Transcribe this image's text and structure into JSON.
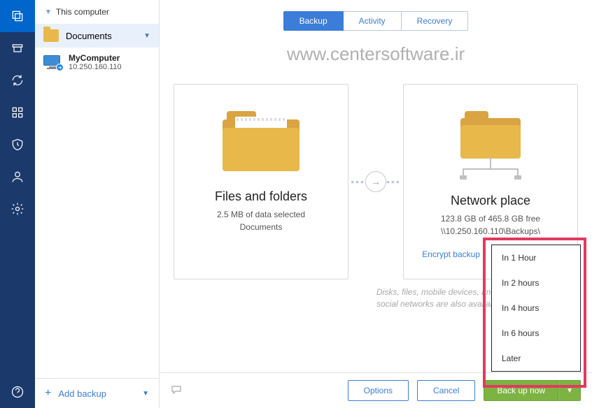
{
  "rail": {
    "items": [
      "copy",
      "archive",
      "sync",
      "grid",
      "shield",
      "user",
      "settings",
      "help"
    ]
  },
  "sidebar": {
    "header": "This computer",
    "documents_label": "Documents",
    "device": {
      "name": "MyComputer",
      "address": "10.250.160.110"
    },
    "add_backup": "Add backup"
  },
  "tabs": {
    "backup": "Backup",
    "activity": "Activity",
    "recovery": "Recovery"
  },
  "watermark": "www.centersoftware.ir",
  "source_card": {
    "title": "Files and folders",
    "line1": "2.5 MB of data selected",
    "line2": "Documents"
  },
  "dest_card": {
    "title": "Network place",
    "line1": "123.8 GB of 465.8 GB free",
    "line2": "\\\\10.250.160.110\\Backups\\"
  },
  "encrypt_link": "Encrypt backup",
  "hint": "Disks, files, mobile devices, and social networks are also available",
  "dropdown": {
    "items": [
      "In 1 Hour",
      "In 2 hours",
      "In 4 hours",
      "In 6 hours",
      "Later"
    ]
  },
  "footer": {
    "options": "Options",
    "cancel": "Cancel",
    "backup_now": "Back up now"
  }
}
